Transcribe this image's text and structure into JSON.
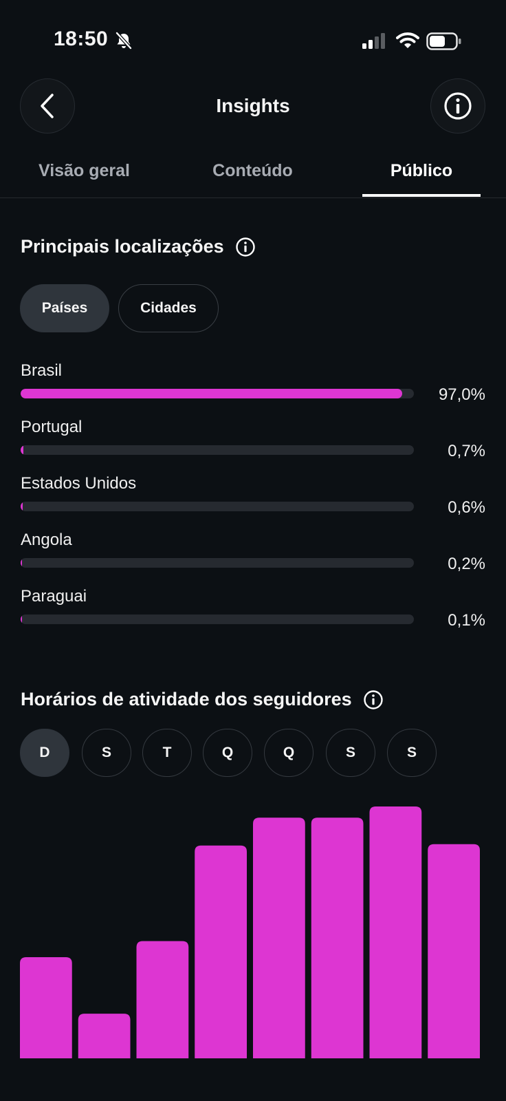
{
  "status_bar": {
    "time": "18:50"
  },
  "header": {
    "title": "Insights"
  },
  "tabs": [
    {
      "label": "Visão geral",
      "active": false
    },
    {
      "label": "Conteúdo",
      "active": false
    },
    {
      "label": "Público",
      "active": true
    }
  ],
  "locations": {
    "title": "Principais localizações",
    "filters": [
      {
        "label": "Países",
        "selected": true
      },
      {
        "label": "Cidades",
        "selected": false
      }
    ],
    "items": [
      {
        "name": "Brasil",
        "value": "97,0%",
        "percent": 97.0
      },
      {
        "name": "Portugal",
        "value": "0,7%",
        "percent": 0.7
      },
      {
        "name": "Estados Unidos",
        "value": "0,6%",
        "percent": 0.6
      },
      {
        "name": "Angola",
        "value": "0,2%",
        "percent": 0.2
      },
      {
        "name": "Paraguai",
        "value": "0,1%",
        "percent": 0.1
      }
    ]
  },
  "activity": {
    "title": "Horários de atividade dos seguidores",
    "days": [
      {
        "label": "D",
        "selected": true
      },
      {
        "label": "S",
        "selected": false
      },
      {
        "label": "T",
        "selected": false
      },
      {
        "label": "Q",
        "selected": false
      },
      {
        "label": "Q",
        "selected": false
      },
      {
        "label": "S",
        "selected": false
      },
      {
        "label": "S",
        "selected": false
      }
    ]
  },
  "colors": {
    "accent": "#dd36d2",
    "background": "#0c1014",
    "track": "#262a30",
    "chip_active": "#2f353c"
  },
  "chart_data": {
    "type": "bar",
    "categories": [
      "",
      "",
      "",
      "",
      "",
      "",
      "",
      ""
    ],
    "values": [
      145,
      64,
      168,
      305,
      345,
      345,
      361,
      307
    ],
    "ylim": [
      0,
      361
    ]
  }
}
